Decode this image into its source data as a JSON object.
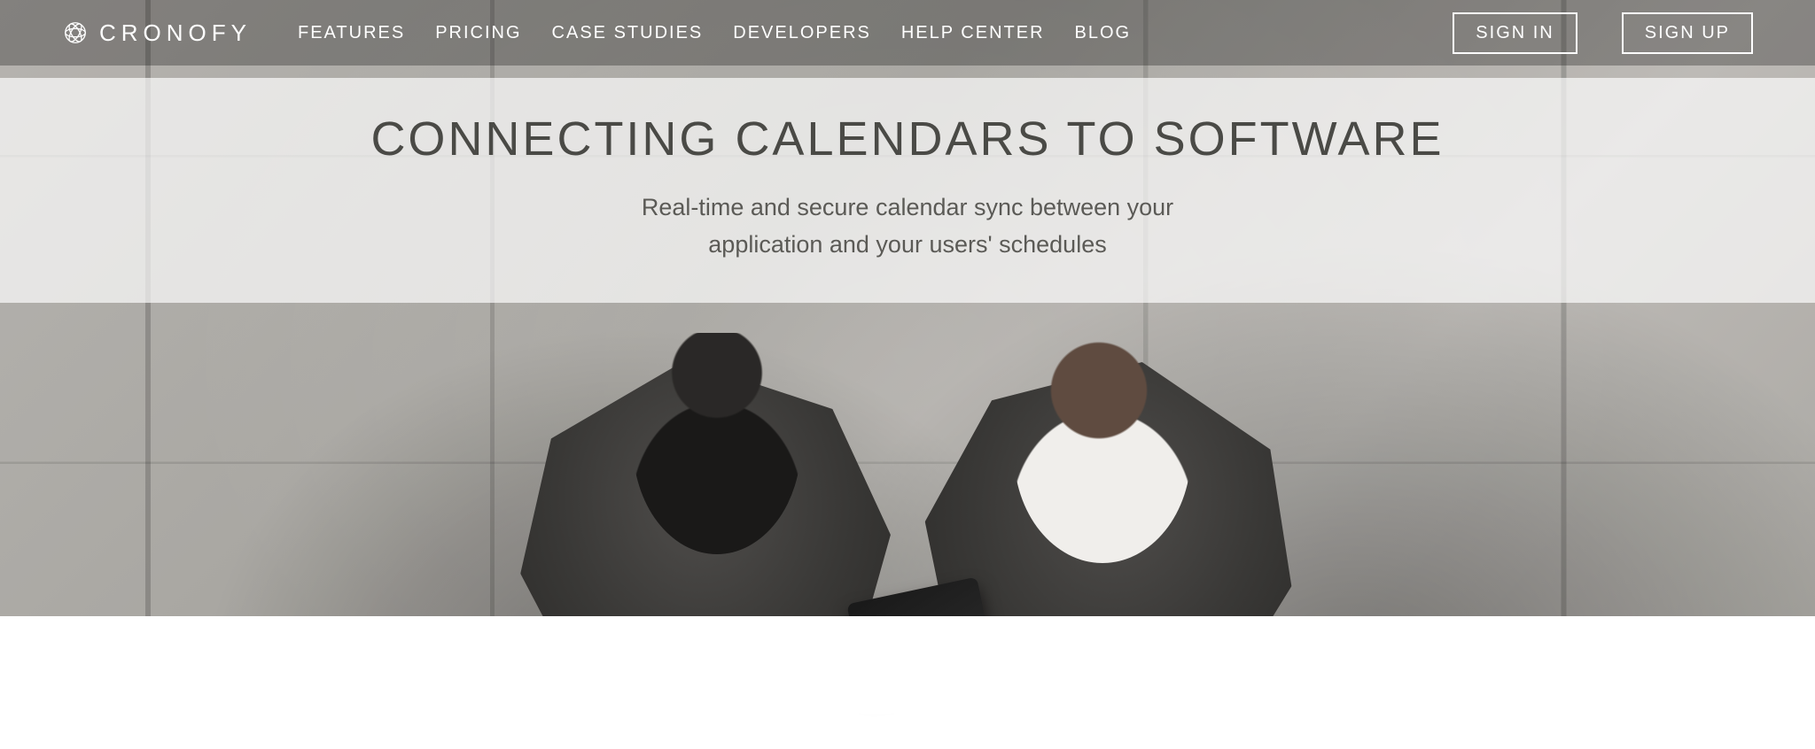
{
  "brand": {
    "name": "CRONOFY"
  },
  "nav": {
    "items": [
      {
        "label": "FEATURES"
      },
      {
        "label": "PRICING"
      },
      {
        "label": "CASE STUDIES"
      },
      {
        "label": "DEVELOPERS"
      },
      {
        "label": "HELP CENTER"
      },
      {
        "label": "BLOG"
      }
    ],
    "sign_in": "SIGN IN",
    "sign_up": "SIGN UP"
  },
  "hero": {
    "headline": "CONNECTING CALENDARS TO SOFTWARE",
    "subline_1": "Real-time and secure calendar sync between your",
    "subline_2": "application and your users' schedules"
  },
  "colors": {
    "nav_overlay": "rgba(0,0,0,0.28)",
    "band_overlay": "rgba(255,255,255,0.68)",
    "text_dark": "#4a4a46",
    "text_light": "#ffffff"
  }
}
